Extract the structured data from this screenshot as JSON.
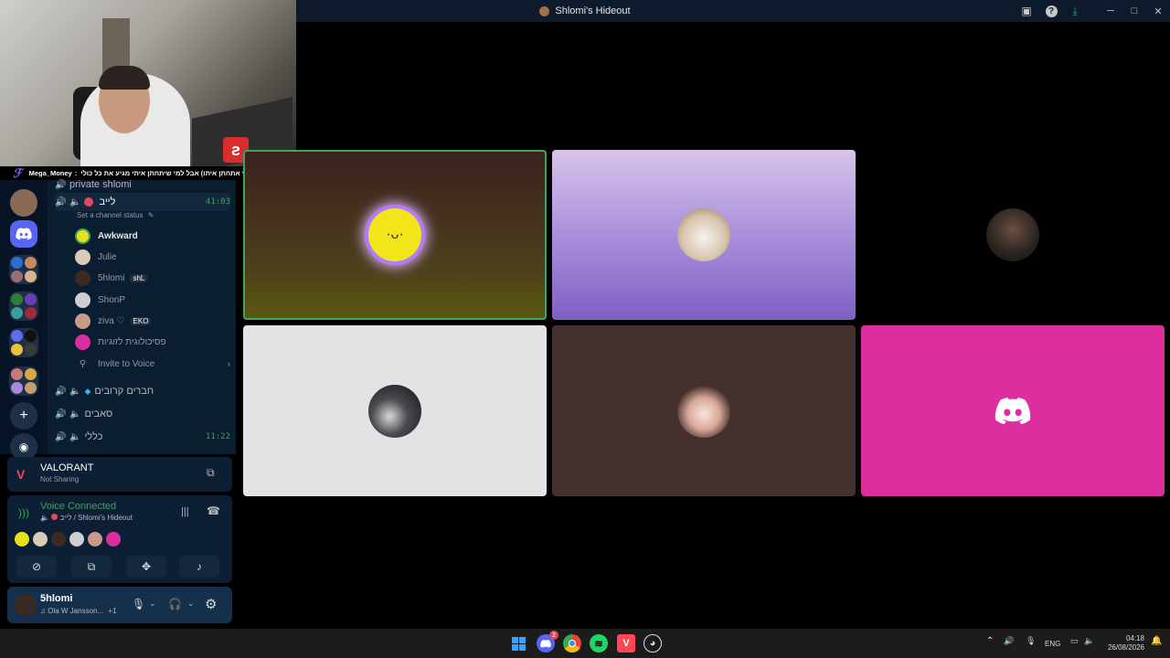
{
  "window": {
    "title": "Shlomi's Hideout"
  },
  "ticker": {
    "author": "Mega_Money",
    "separator": ":",
    "message": "ה קשה מאוד וחשבתי שאני אתחתן איתו) אבל למי שיתחתן איתי מגיע את כל כולי"
  },
  "sidebar": {
    "top_channel": "private shlomi",
    "live_channel": {
      "name": "לייב",
      "time": "41:03",
      "status_placeholder": "Set a channel status"
    },
    "members": [
      {
        "name": "Awkward",
        "color": "#e6e6e6",
        "bold": true,
        "tag": ""
      },
      {
        "name": "Julie",
        "color": "#949ba4",
        "bold": false,
        "tag": ""
      },
      {
        "name": "5hlomi",
        "color": "#949ba4",
        "bold": false,
        "tag": "shL"
      },
      {
        "name": "ShonP",
        "color": "#949ba4",
        "bold": false,
        "tag": ""
      },
      {
        "name": "ziva ♡",
        "color": "#949ba4",
        "bold": false,
        "tag": "EKO"
      },
      {
        "name": "פסיכולוגית לזוגיות",
        "color": "#949ba4",
        "bold": false,
        "tag": ""
      }
    ],
    "invite_label": "Invite to Voice",
    "channels": [
      {
        "name": "חברים קרובים",
        "time": ""
      },
      {
        "name": "סאבים",
        "time": ""
      },
      {
        "name": "כללי",
        "time": "11:22"
      }
    ]
  },
  "activity": {
    "game": "VALORANT",
    "status": "Not Sharing"
  },
  "voice": {
    "title": "Voice Connected",
    "location": "לייב / Shlomi's Hideout",
    "title_color": "#3ba55c"
  },
  "user": {
    "name": "5hlomi",
    "status": "Ola W Jansson...",
    "extra": "+1"
  },
  "tiles": [
    {
      "id": "tile-awkward",
      "bg": "linear-gradient(180deg,#3a211f 0%,#4d3f1b 70%,#5a5a12 100%)",
      "border": "#3ba55c"
    },
    {
      "id": "tile-julie",
      "bg": "linear-gradient(180deg,#d8c3ea 0%,#a990dc 50%,#7f5fc4 100%)",
      "border": ""
    },
    {
      "id": "tile-5hlomi",
      "bg": "#000000",
      "border": ""
    },
    {
      "id": "tile-shonp",
      "bg": "#e3e3e6",
      "border": ""
    },
    {
      "id": "tile-ziva",
      "bg": "#43302f",
      "border": ""
    },
    {
      "id": "tile-psych",
      "bg": "#dd2ea0",
      "border": ""
    }
  ],
  "taskbar": {
    "notification_count": "2",
    "language": "ENG",
    "time": "04:18",
    "date": "26/08/2026"
  }
}
